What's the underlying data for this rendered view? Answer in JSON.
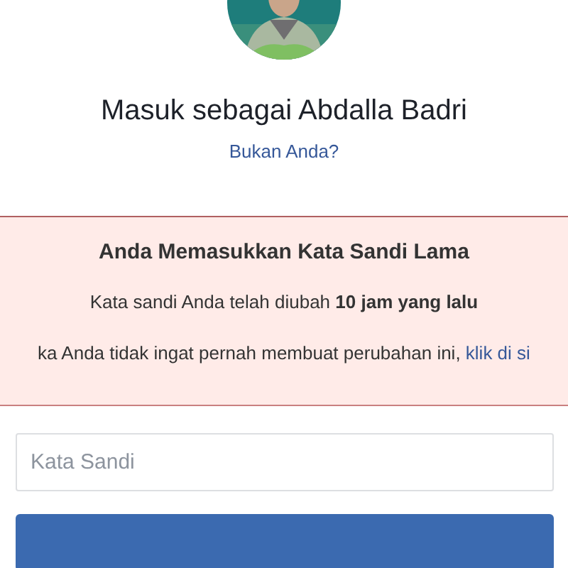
{
  "account": {
    "title": "Masuk sebagai Abdalla Badri",
    "switch_link": "Bukan Anda?"
  },
  "alert": {
    "heading": "Anda Memasukkan Kata Sandi Lama",
    "message": "Kata sandi Anda telah diubah **10 jam yang lalu**",
    "note": "ka Anda tidak ingat pernah membuat perubahan ini, ",
    "note_link": "klik di si"
  },
  "password": {
    "placeholder": "Kata Sandi"
  },
  "submit": {
    "kind": "primary"
  }
}
